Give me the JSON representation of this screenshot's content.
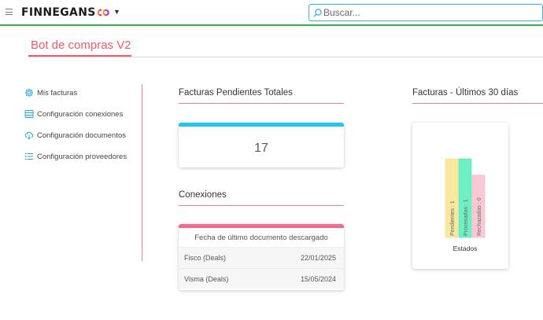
{
  "header": {
    "brand": "FINNEGANS",
    "search_placeholder": "Buscar..."
  },
  "page": {
    "title": "Bot de compras V2"
  },
  "sidebar": {
    "items": [
      {
        "label": "Mis facturas",
        "icon": "gear-icon"
      },
      {
        "label": "Configuración conexiones",
        "icon": "server-icon"
      },
      {
        "label": "Configuración documentos",
        "icon": "cloud-download-icon"
      },
      {
        "label": "Configuración proveedores",
        "icon": "list-icon"
      }
    ]
  },
  "pending": {
    "title": "Facturas Pendientes Totales",
    "count": "17"
  },
  "connections": {
    "title": "Conexiones",
    "column_header": "Fecha de último documento descargado",
    "rows": [
      {
        "name": "Fisco (Deals)",
        "date": "22/01/2025"
      },
      {
        "name": "Visma (Deals)",
        "date": "15/05/2024"
      }
    ]
  },
  "last30": {
    "title": "Facturas - Últimos 30 días"
  },
  "chart_data": {
    "type": "bar",
    "categories": [
      "Estados"
    ],
    "xlabel": "Estados",
    "ylabel": "",
    "ylim": [
      0,
      1.1
    ],
    "series": [
      {
        "name": "Pendientes",
        "values": [
          1
        ],
        "label": "Pendientes : 1",
        "color": "#f7e48d"
      },
      {
        "name": "Procesadas",
        "values": [
          1
        ],
        "label": "Procesadas : 1",
        "color": "#5ee8b8"
      },
      {
        "name": "Rechazadas",
        "values": [
          0
        ],
        "label": "Rechazadas : 0",
        "color": "#f9c0cc"
      }
    ]
  },
  "colors": {
    "accent": "#ef5b6c",
    "header_border": "#2db84d",
    "icon": "#1fa8d8",
    "search_border": "#38b0e0"
  }
}
